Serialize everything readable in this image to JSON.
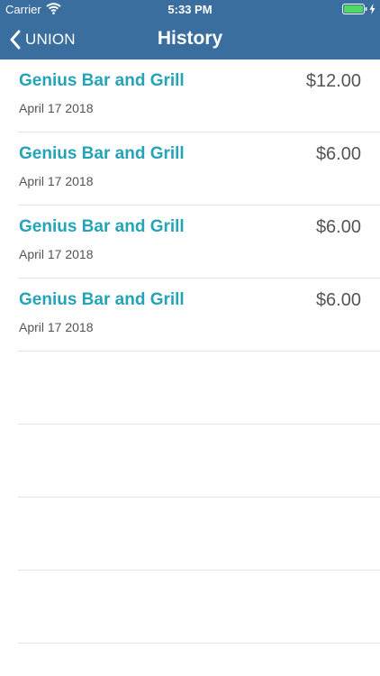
{
  "status_bar": {
    "carrier": "Carrier",
    "time": "5:33 PM",
    "icons": [
      "wifi-icon",
      "battery-icon",
      "charging-bolt-icon"
    ],
    "battery_color": "#4cd964"
  },
  "nav": {
    "back_label": "UNION",
    "back_icon": "chevron-left-icon",
    "title": "History",
    "background_color": "#3a6e9e"
  },
  "history": {
    "accent_color": "#25a3b8",
    "items": [
      {
        "merchant": "Genius Bar and Grill",
        "date": "April 17 2018",
        "amount": "$12.00"
      },
      {
        "merchant": "Genius Bar and Grill",
        "date": "April 17 2018",
        "amount": "$6.00"
      },
      {
        "merchant": "Genius Bar and Grill",
        "date": "April 17 2018",
        "amount": "$6.00"
      },
      {
        "merchant": "Genius Bar and Grill",
        "date": "April 17 2018",
        "amount": "$6.00"
      }
    ]
  }
}
